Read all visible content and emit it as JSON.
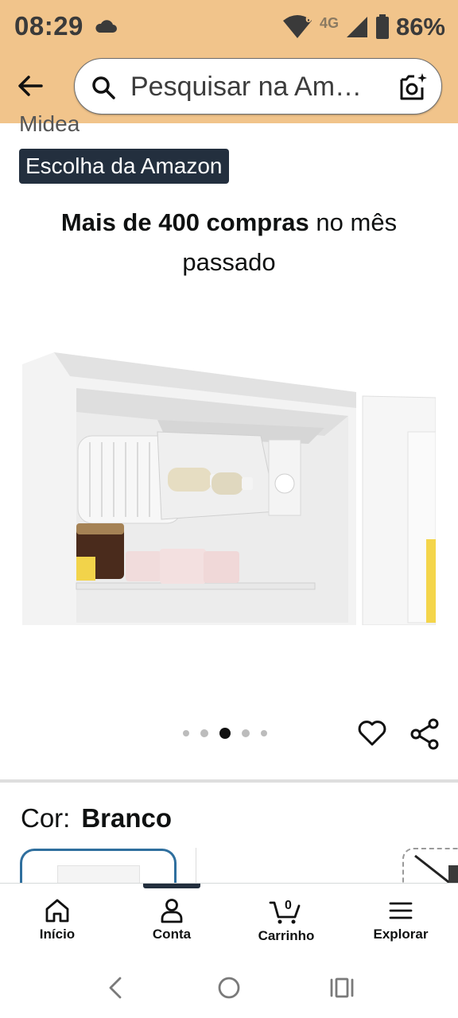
{
  "status_bar": {
    "time": "08:29",
    "network": "4G",
    "signal_badge": "6",
    "battery": "86%",
    "icons": [
      "cloud-icon",
      "wifi-icon",
      "signal-icon",
      "battery-icon"
    ]
  },
  "header": {
    "back_icon": "arrow-left-icon",
    "search_placeholder": "Pesquisar na Am…",
    "search_icon": "search-icon",
    "camera_icon": "camera-scan-icon"
  },
  "product": {
    "brand": "Midea",
    "badge": "Escolha da Amazon",
    "purchases_bold": "Mais de 400 compras",
    "purchases_rest": " no mês passado",
    "image_count": 5,
    "active_image": 3,
    "color_label": "Cor:",
    "color_value": "Branco"
  },
  "bottom_nav": {
    "items": [
      {
        "label": "Início",
        "icon": "home-icon"
      },
      {
        "label": "Conta",
        "icon": "user-icon"
      },
      {
        "label": "Carrinho",
        "icon": "cart-icon",
        "badge": "0"
      },
      {
        "label": "Explorar",
        "icon": "menu-icon"
      }
    ]
  },
  "colors": {
    "header_bg": "#f1c48b",
    "badge_bg": "#232f3e",
    "selected_swatch": "#2f6f9e"
  }
}
